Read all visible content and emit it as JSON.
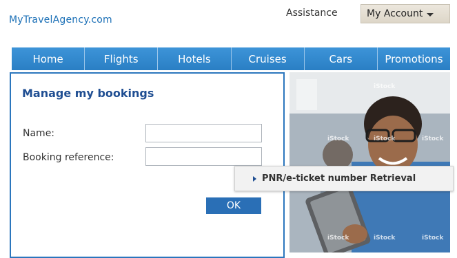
{
  "header": {
    "logo_text": "MyTravelAgency.com",
    "assistance_label": "Assistance",
    "account_label": "My Account"
  },
  "nav": {
    "items": [
      "Home",
      "Flights",
      "Hotels",
      "Cruises",
      "Cars",
      "Promotions"
    ]
  },
  "booking_form": {
    "title": "Manage my bookings",
    "name_label": "Name:",
    "name_value": "",
    "reference_label": "Booking reference:",
    "reference_value": "",
    "ok_label": "OK"
  },
  "retrieval_link": {
    "label": "PNR/e-ticket number Retrieval"
  },
  "photo": {
    "watermark": "iStock"
  },
  "colors": {
    "brand_blue": "#1a6fb6",
    "nav_blue": "#2f86cc",
    "panel_border": "#2b76bd",
    "title_navy": "#1f4e92",
    "button_blue": "#2a6fb6"
  },
  "icons": {
    "account_caret": "chevron-down-icon",
    "link_arrow": "triangle-right-icon"
  }
}
